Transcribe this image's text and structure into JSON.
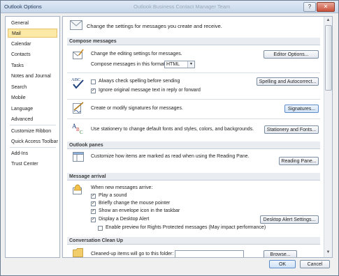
{
  "window": {
    "title": "Outlook Options",
    "ghost_title": "Outlook Business Contact Manager Team",
    "help_glyph": "?",
    "close_glyph": "✕"
  },
  "nav": {
    "items": [
      {
        "label": "General",
        "selected": false
      },
      {
        "label": "Mail",
        "selected": true
      },
      {
        "label": "Calendar",
        "selected": false
      },
      {
        "label": "Contacts",
        "selected": false
      },
      {
        "label": "Tasks",
        "selected": false
      },
      {
        "label": "Notes and Journal",
        "selected": false
      },
      {
        "label": "Search",
        "selected": false
      },
      {
        "label": "Mobile",
        "selected": false
      },
      {
        "label": "Language",
        "selected": false
      },
      {
        "label": "Advanced",
        "selected": false
      },
      {
        "label": "Customize Ribbon",
        "selected": false
      },
      {
        "label": "Quick Access Toolbar",
        "selected": false
      },
      {
        "label": "Add-Ins",
        "selected": false
      },
      {
        "label": "Trust Center",
        "selected": false
      }
    ]
  },
  "main": {
    "header": "Change the settings for messages you create and receive.",
    "compose": {
      "section_title": "Compose messages",
      "editing_label": "Change the editing settings for messages.",
      "editor_options_button": "Editor Options...",
      "format_label": "Compose messages in this format:",
      "format_value": "HTML",
      "always_check_spelling": "Always check spelling before sending",
      "always_check_spelling_checked": false,
      "ignore_original": "Ignore original message text in reply or forward",
      "ignore_original_checked": true,
      "spelling_button": "Spelling and Autocorrect...",
      "signatures_label": "Create or modify signatures for messages.",
      "signatures_button": "Signatures...",
      "stationery_label": "Use stationery to change default fonts and styles, colors, and backgrounds.",
      "stationery_button": "Stationery and Fonts..."
    },
    "panes": {
      "section_title": "Outlook panes",
      "reading_label": "Customize how items are marked as read when using the Reading Pane.",
      "reading_button": "Reading Pane..."
    },
    "arrival": {
      "section_title": "Message arrival",
      "when_label": "When new messages arrive:",
      "play_sound": "Play a sound",
      "play_sound_checked": true,
      "change_pointer": "Briefly change the mouse pointer",
      "change_pointer_checked": true,
      "envelope_icon": "Show an envelope icon in the taskbar",
      "envelope_icon_checked": true,
      "desktop_alert": "Display a Desktop Alert",
      "desktop_alert_checked": true,
      "desktop_alert_button": "Desktop Alert Settings...",
      "rights_protected": "Enable preview for Rights Protected messages (May impact performance)",
      "rights_protected_checked": false
    },
    "cleanup": {
      "section_title": "Conversation Clean Up",
      "folder_label": "Cleaned-up items will go to this folder:",
      "folder_value": "",
      "browse_button": "Browse..."
    }
  },
  "footer": {
    "ok_button": "OK",
    "cancel_button": "Cancel"
  },
  "colors": {
    "selected_nav_bg": "#fde9a6",
    "section_header_bg": "#e9edf2",
    "title_text": "#1e395b"
  },
  "icons": {
    "envelope": "envelope-icon",
    "compose": "compose-envelope-icon",
    "spelling": "abc-check-icon",
    "signature": "signature-pen-icon",
    "stationery": "stationery-abc-icon",
    "reading_pane": "reading-pane-icon",
    "bell": "bell-icon",
    "cleanup": "cleanup-folder-icon"
  }
}
